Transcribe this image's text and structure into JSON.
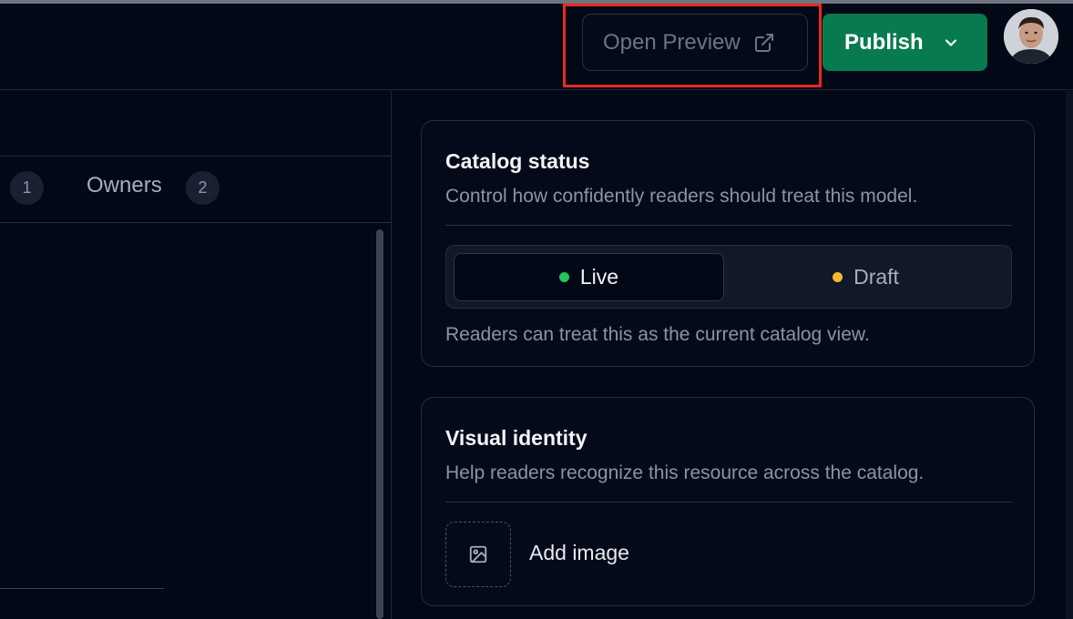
{
  "header": {
    "preview_label": "Open Preview",
    "publish_label": "Publish"
  },
  "tabs": [
    {
      "count": "1"
    },
    {
      "label": "Owners",
      "count": "2"
    }
  ],
  "status_card": {
    "title": "Catalog status",
    "subtitle": "Control how confidently readers should treat this model.",
    "options": [
      {
        "label": "Live",
        "color": "#22c55e",
        "selected": true
      },
      {
        "label": "Draft",
        "color": "#f5b82e",
        "selected": false
      }
    ],
    "hint": "Readers can treat this as the current catalog view."
  },
  "identity_card": {
    "title": "Visual identity",
    "subtitle": "Help readers recognize this resource across the catalog.",
    "add_image_label": "Add image"
  },
  "colors": {
    "background": "#030817",
    "publish": "#087a50",
    "highlight": "#e8291e"
  }
}
